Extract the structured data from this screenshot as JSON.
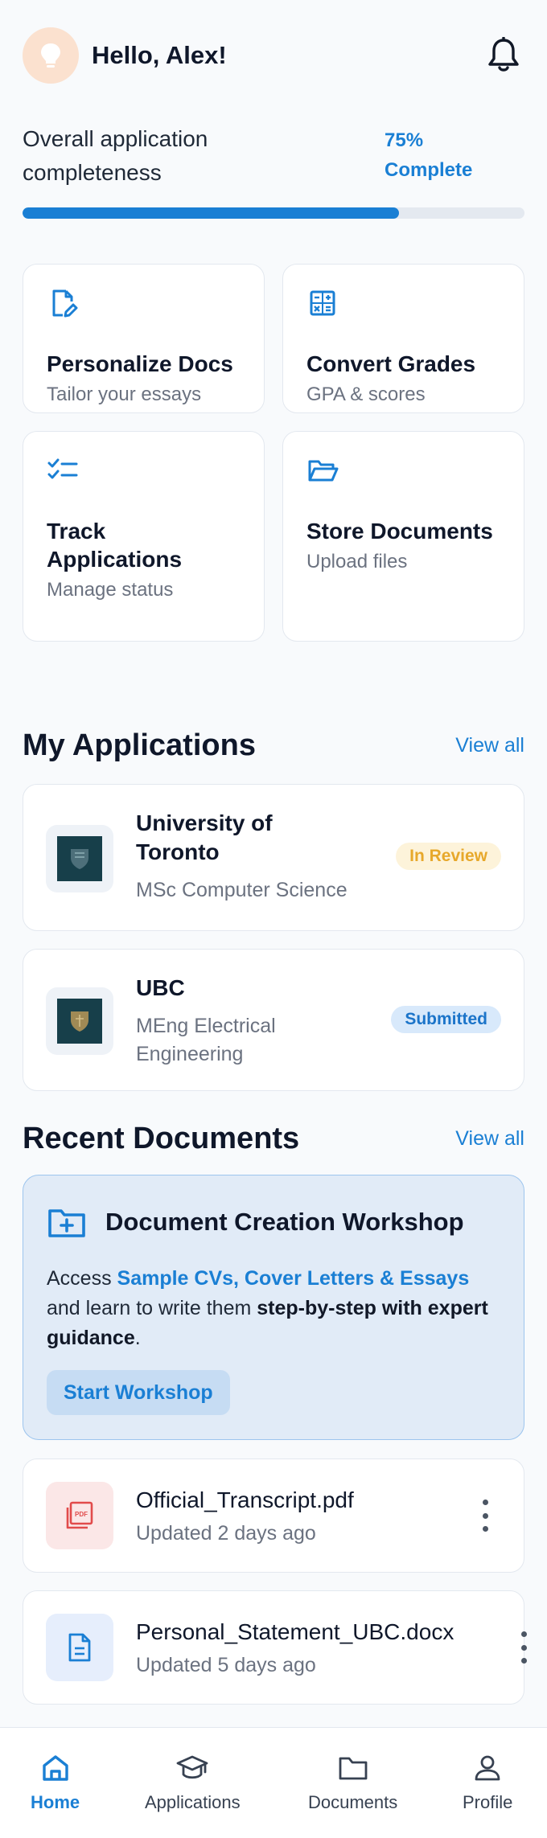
{
  "header": {
    "greeting": "Hello, Alex!",
    "avatar_icon": "lightbulb-icon",
    "notification_icon": "bell-icon"
  },
  "progress": {
    "label": "Overall application completeness",
    "percent_text": "75%",
    "complete_text": "Complete",
    "value": 0.75
  },
  "features": [
    {
      "icon": "edit-document-icon",
      "title": "Personalize Docs",
      "subtitle": "Tailor your essays"
    },
    {
      "icon": "calculator-icon",
      "title": "Convert Grades",
      "subtitle": "GPA & scores"
    },
    {
      "icon": "checklist-icon",
      "title": "Track Applications",
      "subtitle": "Manage status"
    },
    {
      "icon": "folder-open-icon",
      "title": "Store Documents",
      "subtitle": "Upload files"
    }
  ],
  "applications_section": {
    "title": "My Applications",
    "view_all": "View all",
    "items": [
      {
        "name": "University of Toronto",
        "program": "MSc Computer Science",
        "status": "In Review"
      },
      {
        "name": "UBC",
        "program": "MEng Electrical Engineering",
        "status": "Submitted"
      }
    ]
  },
  "documents_section": {
    "title": "Recent Documents",
    "view_all": "View all"
  },
  "workshop": {
    "title": "Document Creation Workshop",
    "text_1": "Access ",
    "highlight": "Sample CVs, Cover Letters & Essays",
    "text_2": " and learn to write them ",
    "bold": "step-by-step with expert guidance",
    "text_3": ".",
    "button": "Start Workshop"
  },
  "documents": [
    {
      "name": "Official_Transcript.pdf",
      "updated": "Updated 2 days ago",
      "icon": "pdf-file-icon"
    },
    {
      "name": "Personal_Statement_UBC.docx",
      "updated": "Updated 5 days ago",
      "icon": "document-file-icon"
    }
  ],
  "nav": [
    {
      "label": "Home",
      "icon": "home-icon",
      "active": true
    },
    {
      "label": "Applications",
      "icon": "graduation-cap-icon",
      "active": false
    },
    {
      "label": "Documents",
      "icon": "folder-icon",
      "active": false
    },
    {
      "label": "Profile",
      "icon": "person-icon",
      "active": false
    }
  ],
  "colors": {
    "accent": "#1a7fd4",
    "background": "#f8fafc",
    "review_badge": "#fdf3da",
    "submitted_badge": "#d8e9fb"
  }
}
